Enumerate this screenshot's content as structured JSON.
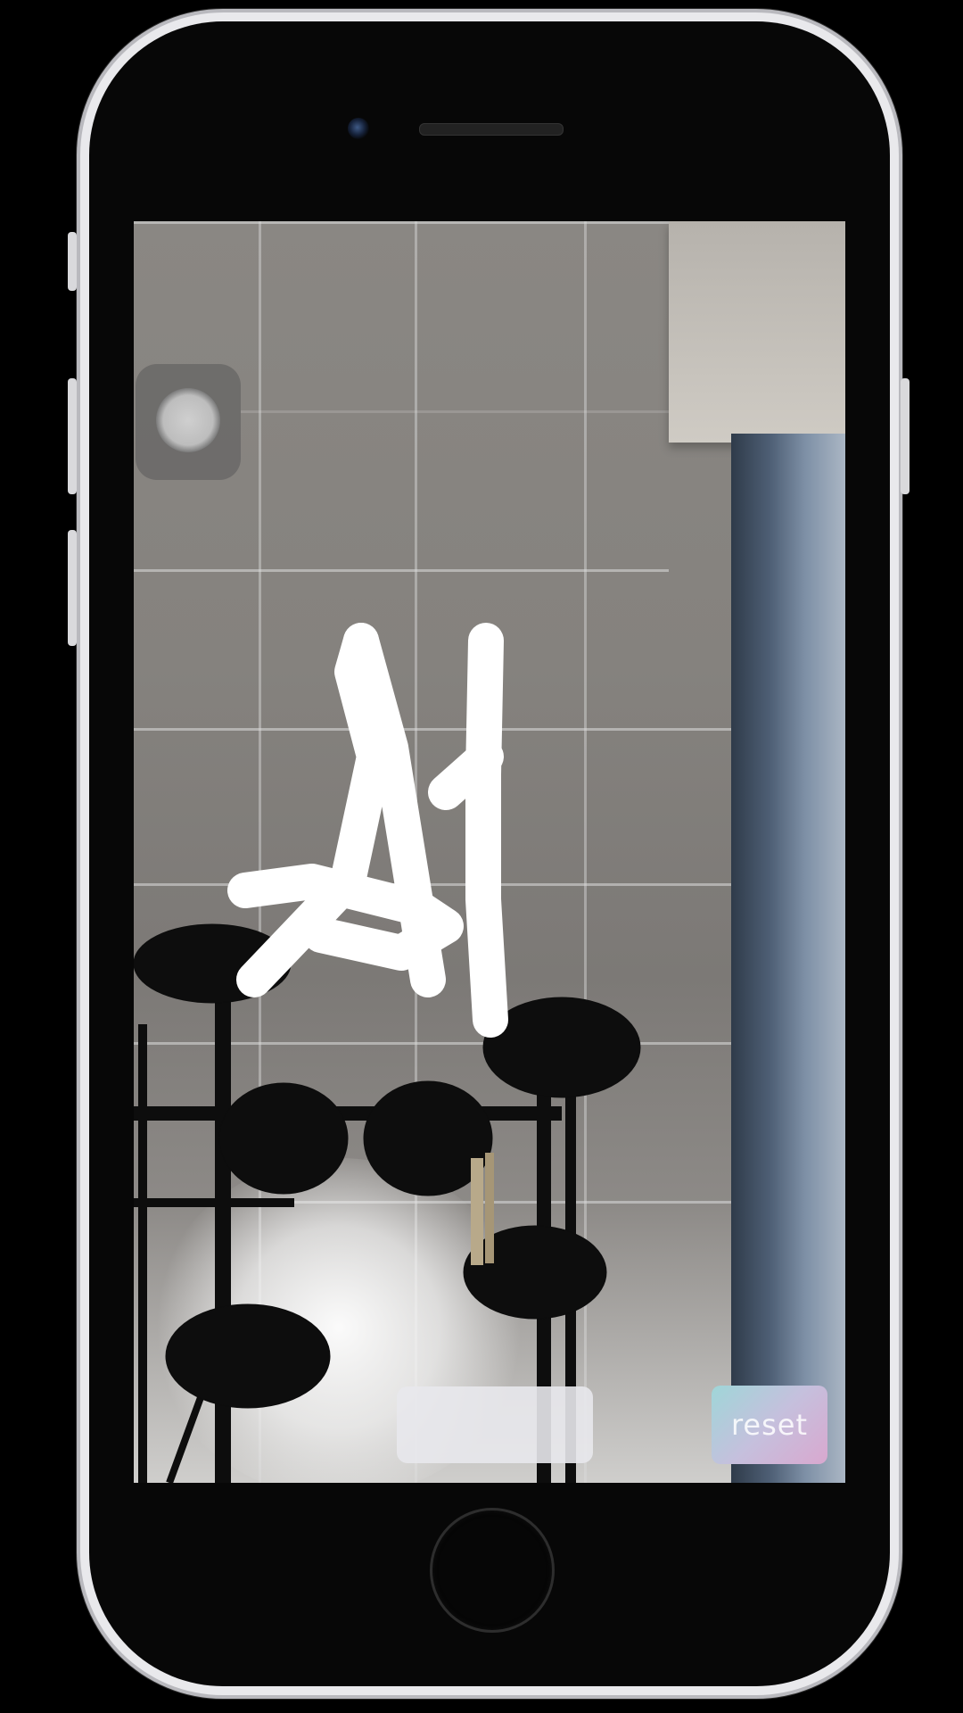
{
  "screen": {
    "controls": {
      "blank_button_label": "",
      "reset_label": "reset"
    },
    "drawing": {
      "label": "AI",
      "stroke_color": "#ffffff"
    },
    "icons": {
      "assistive_touch": "assistive-touch-icon"
    }
  }
}
